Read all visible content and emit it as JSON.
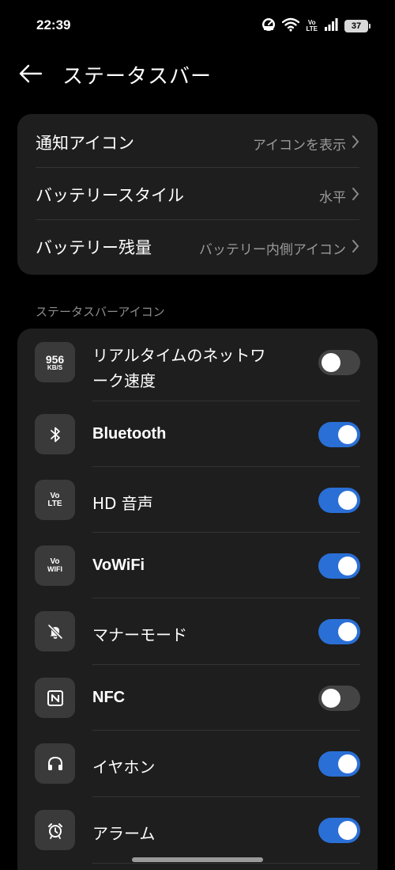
{
  "status_bar": {
    "time": "22:39",
    "volte_top": "Vo",
    "volte_bottom": "LTE",
    "battery": "37"
  },
  "header": {
    "title": "ステータスバー"
  },
  "settings": [
    {
      "label": "通知アイコン",
      "value": "アイコンを表示"
    },
    {
      "label": "バッテリースタイル",
      "value": "水平"
    },
    {
      "label": "バッテリー残量",
      "value": "バッテリー内側アイコン"
    }
  ],
  "section_title": "ステータスバーアイコン",
  "icon_toggles": [
    {
      "label_line1": "リアルタイムのネットワ",
      "label_line2": "ーク速度",
      "icon": "network-speed-icon",
      "icon_text_top": "956",
      "icon_text_bottom": "KB/S",
      "enabled": false
    },
    {
      "label": "Bluetooth",
      "icon": "bluetooth-icon",
      "enabled": true
    },
    {
      "label": "HD 音声",
      "icon": "volte-icon",
      "icon_text_top": "Vo",
      "icon_text_bottom": "LTE",
      "enabled": true
    },
    {
      "label": "VoWiFi",
      "icon": "vowifi-icon",
      "icon_text_top": "Vo",
      "icon_text_bottom": "WIFI",
      "enabled": true
    },
    {
      "label": "マナーモード",
      "icon": "bell-off-icon",
      "enabled": true
    },
    {
      "label": "NFC",
      "icon": "nfc-icon",
      "enabled": false
    },
    {
      "label": "イヤホン",
      "icon": "headphones-icon",
      "enabled": true
    },
    {
      "label": "アラーム",
      "icon": "alarm-icon",
      "enabled": true
    }
  ],
  "colors": {
    "background": "#000000",
    "card": "#1e1e1e",
    "toggle_on": "#2a6fd6",
    "toggle_off": "#444444"
  }
}
